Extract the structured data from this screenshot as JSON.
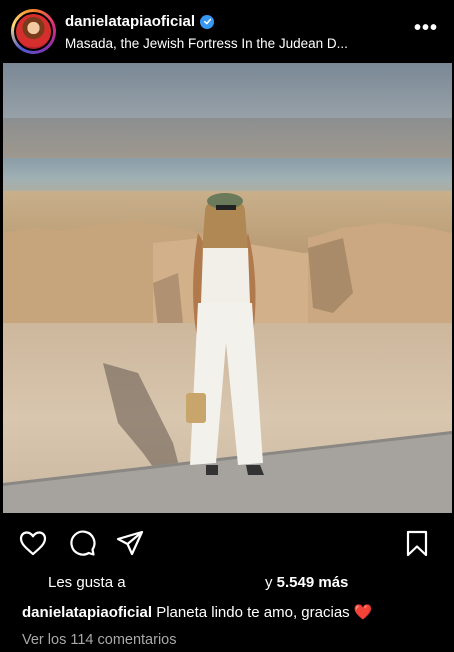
{
  "header": {
    "username": "danielatapiaoficial",
    "location": "Masada, the Jewish Fortress In the Judean D...",
    "more_icon": "•••"
  },
  "post": {
    "likes_prefix": "Les gusta a",
    "likes_suffix": "y ",
    "likes_count": "5.549 más",
    "caption_user": "danielatapiaoficial",
    "caption_text": "Planeta lindo te amo, gracias",
    "caption_emoji": "❤️",
    "comments_link": "Ver los 114 comentarios"
  },
  "icons": {
    "like": "heart-icon",
    "comment": "comment-icon",
    "share": "send-icon",
    "save": "bookmark-icon",
    "verified": "verified-badge-icon"
  },
  "colors": {
    "background": "#000000",
    "verified_blue": "#3897f0",
    "heart_red": "#ff3040",
    "muted_text": "#a8a8a8"
  }
}
